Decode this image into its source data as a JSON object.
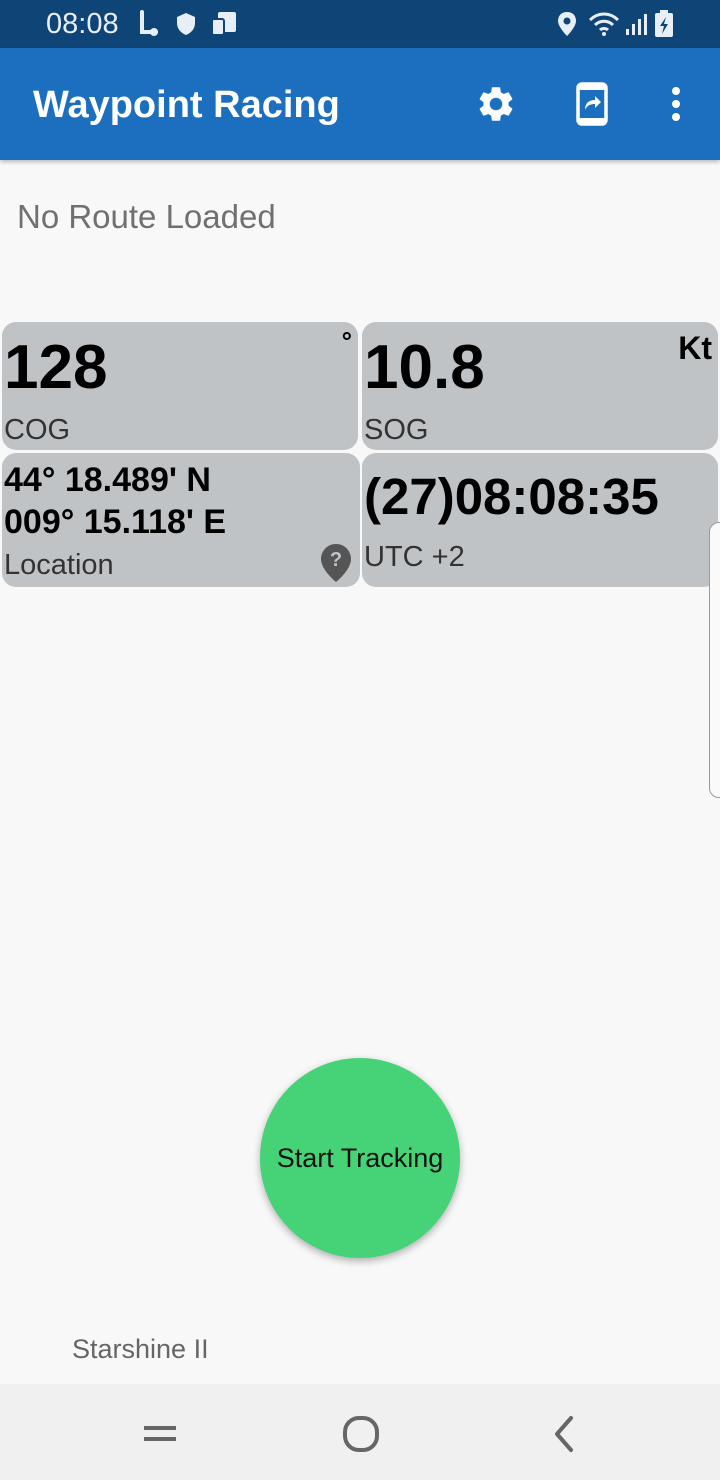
{
  "status_bar": {
    "time": "08:08",
    "icons": [
      "steps-notification-icon",
      "shield-icon",
      "screen-mirror-icon",
      "location-pin-icon",
      "wifi-icon",
      "signal-bars-icon",
      "battery-charging-icon"
    ]
  },
  "app_bar": {
    "title": "Waypoint Racing",
    "actions": [
      "settings-icon",
      "share-phone-icon",
      "overflow-menu-icon"
    ]
  },
  "route": {
    "status": "No Route Loaded"
  },
  "tiles": {
    "cog": {
      "value": "128",
      "unit": "°",
      "label": "COG"
    },
    "sog": {
      "value": "10.8",
      "unit": "Kt",
      "label": "SOG"
    },
    "location": {
      "lat": "44° 18.489' N",
      "lon": "009° 15.118' E",
      "label": "Location"
    },
    "time": {
      "value": "(27)08:08:35",
      "label": "UTC +2"
    }
  },
  "fab": {
    "label": "Start Tracking"
  },
  "boat": {
    "name": "Starshine II"
  },
  "nav_bar": {
    "buttons": [
      "recent-apps-icon",
      "home-icon",
      "back-icon"
    ]
  },
  "colors": {
    "status_bar": "#0f4477",
    "app_bar": "#1c6fbe",
    "tile": "#c0c3c6",
    "fab": "#46d377",
    "background": "#f8f8f8"
  }
}
